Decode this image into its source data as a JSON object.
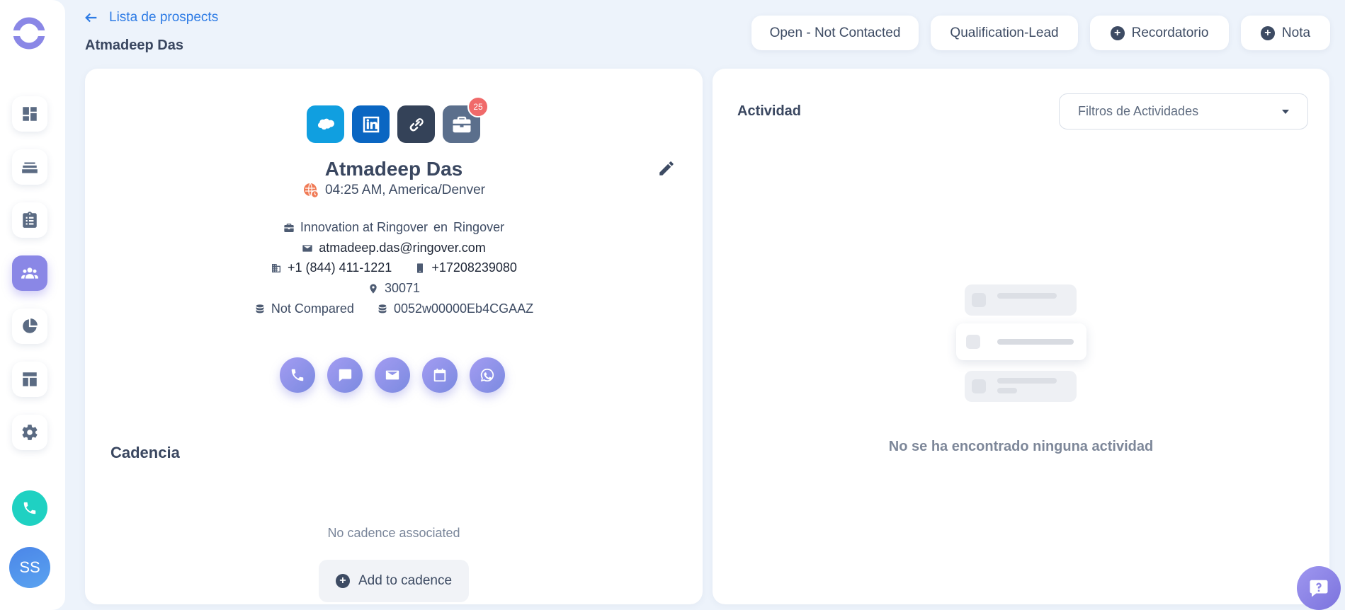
{
  "colors": {
    "background": "#edf3fb",
    "accent": "#8a87e6",
    "link": "#2d7be5",
    "badge": "#f06a6a",
    "phone": "#1fd1c2"
  },
  "sidebar": {
    "items": [
      {
        "icon": "dashboard-icon"
      },
      {
        "icon": "layers-icon"
      },
      {
        "icon": "clipboard-icon"
      },
      {
        "icon": "users-icon",
        "active": true
      },
      {
        "icon": "pie-chart-icon"
      },
      {
        "icon": "layout-icon"
      },
      {
        "icon": "gear-icon"
      }
    ],
    "avatar_initials": "SS"
  },
  "header": {
    "back_label": "Lista de prospects",
    "title": "Atmadeep Das",
    "buttons": {
      "status": "Open - Not Contacted",
      "stage": "Qualification-Lead",
      "reminder": "Recordatorio",
      "note": "Nota"
    }
  },
  "profile": {
    "badge_count": "25",
    "name": "Atmadeep Das",
    "local_time": "04:25 AM, America/Denver",
    "position": "Innovation at Ringover",
    "company_connector": "en",
    "company": "Ringover",
    "email": "atmadeep.das@ringover.com",
    "phone_office": "+1 (844) 411-1221",
    "phone_mobile": "+17208239080",
    "zip": "30071",
    "crm_status": "Not Compared",
    "crm_id": "0052w00000Eb4CGAAZ"
  },
  "cadence": {
    "title": "Cadencia",
    "empty_text": "No cadence associated",
    "add_label": "Add to cadence"
  },
  "activity": {
    "title": "Actividad",
    "filter_label": "Filtros de Actividades",
    "empty_text": "No se ha encontrado ninguna actividad"
  }
}
